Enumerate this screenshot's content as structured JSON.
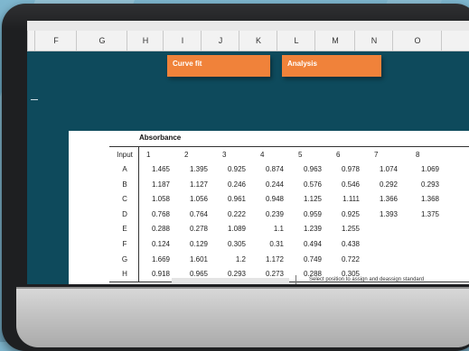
{
  "columns": [
    "F",
    "G",
    "H",
    "I",
    "J",
    "K",
    "L",
    "M",
    "N",
    "O"
  ],
  "buttons": {
    "curve_fit": "Curve fit",
    "analysis": "Analysis"
  },
  "table": {
    "caption": "Absorbance",
    "row_header": "Input",
    "col_headers": [
      "1",
      "2",
      "3",
      "4",
      "5",
      "6",
      "7",
      "8"
    ],
    "rows": [
      {
        "label": "A",
        "values": [
          "1.465",
          "1.395",
          "0.925",
          "0.874",
          "0.963",
          "0.978",
          "1.074",
          "1.069"
        ]
      },
      {
        "label": "B",
        "values": [
          "1.187",
          "1.127",
          "0.246",
          "0.244",
          "0.576",
          "0.546",
          "0.292",
          "0.293"
        ]
      },
      {
        "label": "C",
        "values": [
          "1.058",
          "1.056",
          "0.961",
          "0.948",
          "1.125",
          "1.111",
          "1.366",
          "1.368"
        ]
      },
      {
        "label": "D",
        "values": [
          "0.768",
          "0.764",
          "0.222",
          "0.239",
          "0.959",
          "0.925",
          "1.393",
          "1.375"
        ]
      },
      {
        "label": "E",
        "values": [
          "0.288",
          "0.278",
          "1.089",
          "1.1",
          "1.239",
          "1.255",
          "",
          ""
        ]
      },
      {
        "label": "F",
        "values": [
          "0.124",
          "0.129",
          "0.305",
          "0.31",
          "0.494",
          "0.438",
          "",
          ""
        ]
      },
      {
        "label": "G",
        "values": [
          "1.669",
          "1.601",
          "1.2",
          "1.172",
          "0.749",
          "0.722",
          "",
          ""
        ]
      },
      {
        "label": "H",
        "values": [
          "0.918",
          "0.965",
          "0.293",
          "0.273",
          "0.288",
          "0.305",
          "",
          ""
        ]
      }
    ]
  },
  "hint": "Select position to assign and deassign standard"
}
